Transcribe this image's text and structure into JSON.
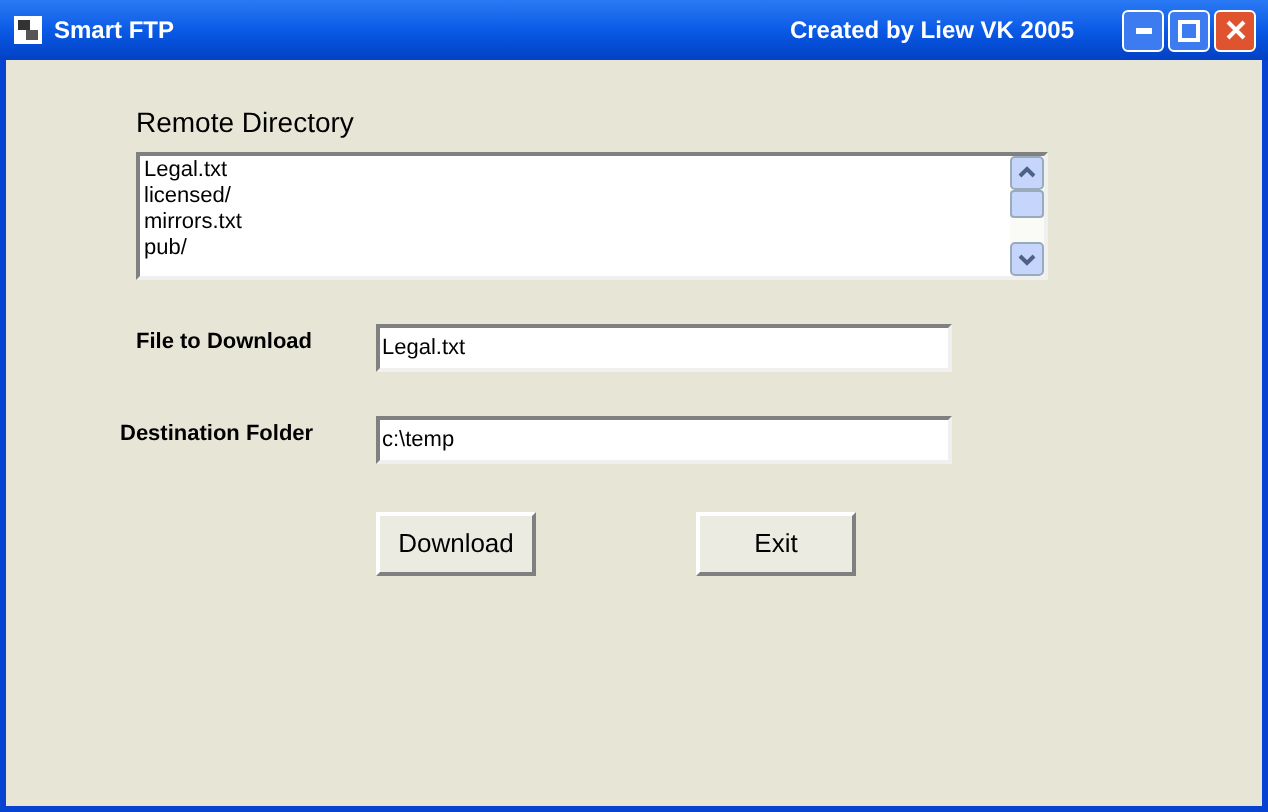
{
  "window": {
    "title": "Smart FTP",
    "caption": "Created by Liew VK 2005"
  },
  "remote_directory": {
    "label": "Remote Directory",
    "items": [
      "Legal.txt",
      "licensed/",
      "mirrors.txt",
      "pub/"
    ]
  },
  "fields": [
    {
      "label": "File to Download",
      "value": "Legal.txt"
    },
    {
      "label": "Destination Folder",
      "value": "c:\\temp"
    }
  ],
  "buttons": [
    "Download",
    "Exit"
  ]
}
